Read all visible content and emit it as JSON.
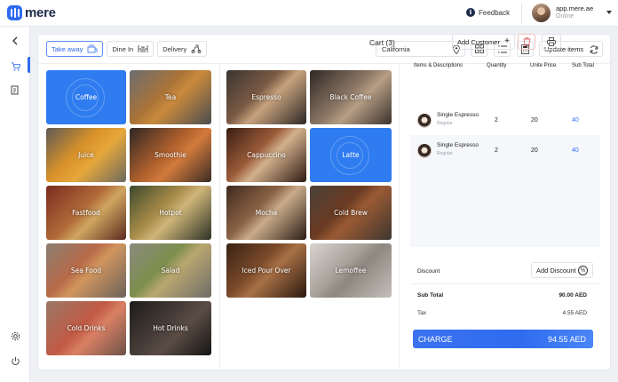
{
  "app": {
    "name": "mere"
  },
  "header": {
    "feedback_label": "Feedback",
    "user_url": "app.mere.ae",
    "user_status": "Online"
  },
  "order_types": [
    {
      "label": "Take away",
      "icon": "takeaway-icon",
      "active": true
    },
    {
      "label": "Dine In",
      "icon": "dine-in-icon",
      "active": false
    },
    {
      "label": "Delivery",
      "icon": "delivery-icon",
      "active": false
    }
  ],
  "toolbar": {
    "location": "California",
    "update_label": "Update items"
  },
  "categories": [
    {
      "label": "Coffee",
      "selected": true
    },
    {
      "label": "Tea"
    },
    {
      "label": "Juice"
    },
    {
      "label": "Smoothie"
    },
    {
      "label": "Fastfood"
    },
    {
      "label": "Hotpot"
    },
    {
      "label": "Sea Food"
    },
    {
      "label": "Salad"
    },
    {
      "label": "Cold Drinks"
    },
    {
      "label": "Hot Drinks"
    }
  ],
  "products": [
    {
      "label": "Espresso"
    },
    {
      "label": "Black Coffee"
    },
    {
      "label": "Cappuccino"
    },
    {
      "label": "Latte",
      "selected": true
    },
    {
      "label": "Mocha"
    },
    {
      "label": "Cold Brew"
    },
    {
      "label": "Iced Pour Over"
    },
    {
      "label": "Lemoffee"
    }
  ],
  "cart": {
    "title": "Cart (3)",
    "add_customer_label": "Add Customer",
    "columns": [
      "Items & Descriptions",
      "Quantity",
      "Unite Price",
      "Sub Total"
    ],
    "items": [
      {
        "name": "Single Espresso",
        "size": "Regular",
        "qty": "2",
        "price": "20",
        "subtotal": "40"
      },
      {
        "name": "Single Espresso",
        "size": "Regular",
        "qty": "2",
        "price": "20",
        "subtotal": "40"
      }
    ],
    "discount_label": "Discount",
    "add_discount_label": "Add Discount",
    "subtotal_label": "Sub Total",
    "subtotal_value": "90.00 AED",
    "tax_label": "Tax",
    "tax_value": "4.55 AED",
    "charge_label": "CHARGE",
    "charge_value": "94.55 AED"
  },
  "colors": {
    "accent": "#2f6bf2",
    "danger": "#e05454"
  }
}
